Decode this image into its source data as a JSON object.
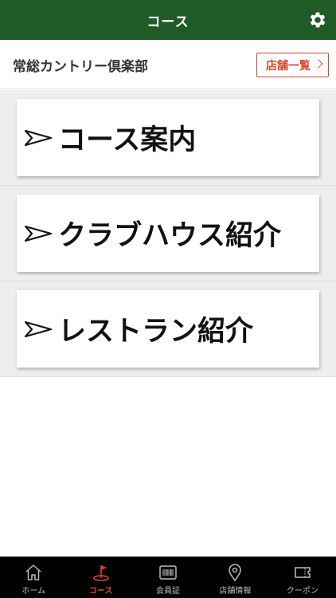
{
  "header": {
    "title": "コース",
    "settings_icon": "gear-icon",
    "background": "#1f5a27"
  },
  "store": {
    "name": "常総カントリー倶楽部",
    "list_button_label": "店舗一覧",
    "accent": "#d9482b"
  },
  "menu": {
    "items": [
      {
        "label": "コース案内",
        "icon": "arrow-right-icon"
      },
      {
        "label": "クラブハウス紹介",
        "icon": "arrow-right-icon"
      },
      {
        "label": "レストラン紹介",
        "icon": "arrow-right-icon"
      }
    ]
  },
  "tabbar": {
    "items": [
      {
        "label": "ホーム",
        "icon": "home-icon",
        "active": false
      },
      {
        "label": "コース",
        "icon": "golf-flag-icon",
        "active": true
      },
      {
        "label": "会員証",
        "icon": "barcode-card-icon",
        "active": false
      },
      {
        "label": "店舗情報",
        "icon": "map-pin-icon",
        "active": false
      },
      {
        "label": "クーポン",
        "icon": "coupon-icon",
        "active": false
      }
    ],
    "active_color": "#e0452b"
  }
}
